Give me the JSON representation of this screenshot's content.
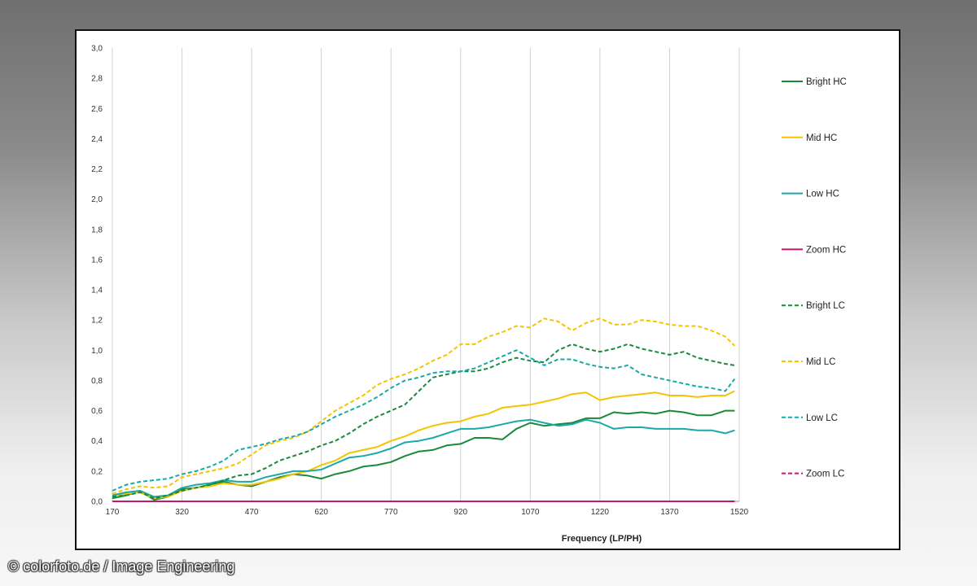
{
  "credit": "© colorfoto.de / Image Engineering",
  "chart_data": {
    "type": "line",
    "xlabel": "Frequency (LP/PH)",
    "ylabel": "",
    "xlim": [
      170,
      1520
    ],
    "ylim": [
      0,
      3.0
    ],
    "xticks": [
      "170",
      "320",
      "470",
      "620",
      "770",
      "920",
      "1070",
      "1220",
      "1370",
      "1520"
    ],
    "yticks": [
      "0,0",
      "0,2",
      "0,4",
      "0,6",
      "0,8",
      "1,0",
      "1,2",
      "1,4",
      "1,6",
      "1,8",
      "2,0",
      "2,2",
      "2,4",
      "2,6",
      "2,8",
      "3,0"
    ],
    "grid": "vertical",
    "legend": "right",
    "x": [
      170,
      200,
      230,
      260,
      290,
      320,
      350,
      380,
      410,
      440,
      470,
      500,
      530,
      560,
      590,
      620,
      650,
      680,
      710,
      740,
      770,
      800,
      830,
      860,
      890,
      920,
      950,
      980,
      1010,
      1040,
      1070,
      1100,
      1130,
      1160,
      1190,
      1220,
      1250,
      1280,
      1310,
      1340,
      1370,
      1400,
      1430,
      1460,
      1490,
      1510
    ],
    "series": [
      {
        "name": "Bright HC",
        "color": "#1a8a3a",
        "dash": false,
        "values": [
          0.02,
          0.04,
          0.07,
          0.01,
          0.03,
          0.08,
          0.09,
          0.11,
          0.13,
          0.11,
          0.1,
          0.13,
          0.16,
          0.18,
          0.17,
          0.15,
          0.18,
          0.2,
          0.23,
          0.24,
          0.26,
          0.3,
          0.33,
          0.34,
          0.37,
          0.38,
          0.42,
          0.42,
          0.41,
          0.48,
          0.52,
          0.5,
          0.51,
          0.52,
          0.55,
          0.55,
          0.59,
          0.58,
          0.59,
          0.58,
          0.6,
          0.59,
          0.57,
          0.57,
          0.6,
          0.6
        ]
      },
      {
        "name": "Mid HC",
        "color": "#f5c400",
        "dash": false,
        "values": [
          0.03,
          0.05,
          0.06,
          0.02,
          0.03,
          0.07,
          0.09,
          0.1,
          0.12,
          0.11,
          0.11,
          0.13,
          0.15,
          0.18,
          0.2,
          0.24,
          0.27,
          0.32,
          0.34,
          0.36,
          0.4,
          0.43,
          0.47,
          0.5,
          0.52,
          0.53,
          0.56,
          0.58,
          0.62,
          0.63,
          0.64,
          0.66,
          0.68,
          0.71,
          0.72,
          0.67,
          0.69,
          0.7,
          0.71,
          0.72,
          0.7,
          0.7,
          0.69,
          0.7,
          0.7,
          0.73
        ]
      },
      {
        "name": "Low HC",
        "color": "#1aa8a8",
        "dash": false,
        "values": [
          0.04,
          0.06,
          0.07,
          0.03,
          0.04,
          0.09,
          0.11,
          0.12,
          0.14,
          0.13,
          0.13,
          0.16,
          0.18,
          0.2,
          0.2,
          0.21,
          0.25,
          0.29,
          0.3,
          0.32,
          0.35,
          0.39,
          0.4,
          0.42,
          0.45,
          0.48,
          0.48,
          0.49,
          0.51,
          0.53,
          0.54,
          0.52,
          0.5,
          0.51,
          0.54,
          0.52,
          0.48,
          0.49,
          0.49,
          0.48,
          0.48,
          0.48,
          0.47,
          0.47,
          0.45,
          0.47
        ]
      },
      {
        "name": "Zoom HC",
        "color": "#c2186b",
        "dash": false,
        "values": [
          0,
          0,
          0,
          0,
          0,
          0,
          0,
          0,
          0,
          0,
          0,
          0,
          0,
          0,
          0,
          0,
          0,
          0,
          0,
          0,
          0,
          0,
          0,
          0,
          0,
          0,
          0,
          0,
          0,
          0,
          0,
          0,
          0,
          0,
          0,
          0,
          0,
          0,
          0,
          0,
          0,
          0,
          0,
          0,
          0,
          0
        ]
      },
      {
        "name": "Bright LC",
        "color": "#1a8a3a",
        "dash": true,
        "values": [
          0.03,
          0.04,
          0.06,
          0.02,
          0.04,
          0.07,
          0.09,
          0.11,
          0.14,
          0.17,
          0.18,
          0.22,
          0.27,
          0.3,
          0.33,
          0.37,
          0.4,
          0.45,
          0.51,
          0.56,
          0.6,
          0.64,
          0.73,
          0.82,
          0.84,
          0.86,
          0.86,
          0.88,
          0.92,
          0.95,
          0.93,
          0.92,
          1.0,
          1.04,
          1.01,
          0.99,
          1.01,
          1.04,
          1.01,
          0.99,
          0.97,
          0.99,
          0.95,
          0.93,
          0.91,
          0.9
        ]
      },
      {
        "name": "Mid LC",
        "color": "#f5c400",
        "dash": true,
        "values": [
          0.05,
          0.08,
          0.1,
          0.09,
          0.1,
          0.16,
          0.18,
          0.2,
          0.22,
          0.25,
          0.31,
          0.37,
          0.4,
          0.42,
          0.46,
          0.53,
          0.6,
          0.65,
          0.7,
          0.77,
          0.81,
          0.84,
          0.88,
          0.93,
          0.97,
          1.04,
          1.04,
          1.09,
          1.12,
          1.16,
          1.15,
          1.21,
          1.19,
          1.13,
          1.18,
          1.21,
          1.17,
          1.17,
          1.2,
          1.19,
          1.17,
          1.16,
          1.16,
          1.13,
          1.09,
          1.03
        ]
      },
      {
        "name": "Low LC",
        "color": "#1aa8a8",
        "dash": true,
        "values": [
          0.07,
          0.11,
          0.13,
          0.14,
          0.15,
          0.18,
          0.2,
          0.23,
          0.27,
          0.34,
          0.36,
          0.38,
          0.41,
          0.43,
          0.46,
          0.51,
          0.56,
          0.6,
          0.64,
          0.69,
          0.75,
          0.8,
          0.82,
          0.85,
          0.86,
          0.86,
          0.88,
          0.92,
          0.96,
          1.0,
          0.95,
          0.9,
          0.94,
          0.94,
          0.91,
          0.89,
          0.88,
          0.9,
          0.84,
          0.82,
          0.8,
          0.78,
          0.76,
          0.75,
          0.73,
          0.81
        ]
      },
      {
        "name": "Zoom LC",
        "color": "#c2186b",
        "dash": true,
        "values": [
          0,
          0,
          0,
          0,
          0,
          0,
          0,
          0,
          0,
          0,
          0,
          0,
          0,
          0,
          0,
          0,
          0,
          0,
          0,
          0,
          0,
          0,
          0,
          0,
          0,
          0,
          0,
          0,
          0,
          0,
          0,
          0,
          0,
          0,
          0,
          0,
          0,
          0,
          0,
          0,
          0,
          0,
          0,
          0,
          0,
          0
        ]
      }
    ]
  }
}
